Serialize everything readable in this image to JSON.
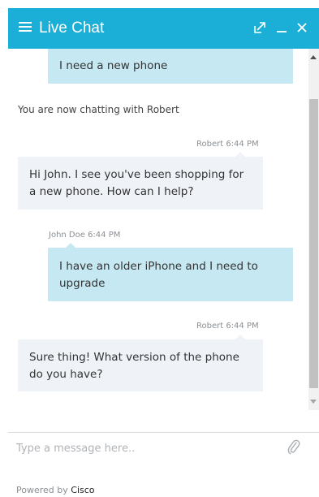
{
  "header": {
    "title": "Live Chat",
    "menu_icon": "hamburger-menu-icon",
    "popout_icon": "popout-icon",
    "minimize_icon": "minimize-icon",
    "close_icon": "close-icon",
    "background_color": "#1bafd8"
  },
  "messages": [
    {
      "sender": "",
      "time": "",
      "text": "I need a new phone",
      "type": "user"
    },
    {
      "type": "system",
      "text": "You are now chatting with Robert"
    },
    {
      "sender": "Robert",
      "time": "6:44 PM",
      "meta": "Robert 6:44 PM",
      "text": "Hi John. I see you've been shopping for a new phone. How can I help?",
      "type": "agent"
    },
    {
      "sender": "John Doe",
      "time": "6:44 PM",
      "meta": "John Doe 6:44 PM",
      "text": "I have an older iPhone and I need to upgrade",
      "type": "user"
    },
    {
      "sender": "Robert",
      "time": "6:44 PM",
      "meta": "Robert 6:44 PM",
      "text": "Sure thing! What version of the phone do you have?",
      "type": "agent"
    }
  ],
  "composer": {
    "placeholder": "Type a message here..",
    "value": "",
    "attach_icon": "paperclip-icon"
  },
  "footer": {
    "powered_prefix": "Powered by",
    "brand": "Cisco"
  },
  "colors": {
    "user_bubble": "#c5e8f3",
    "agent_bubble": "#eff3f8"
  }
}
